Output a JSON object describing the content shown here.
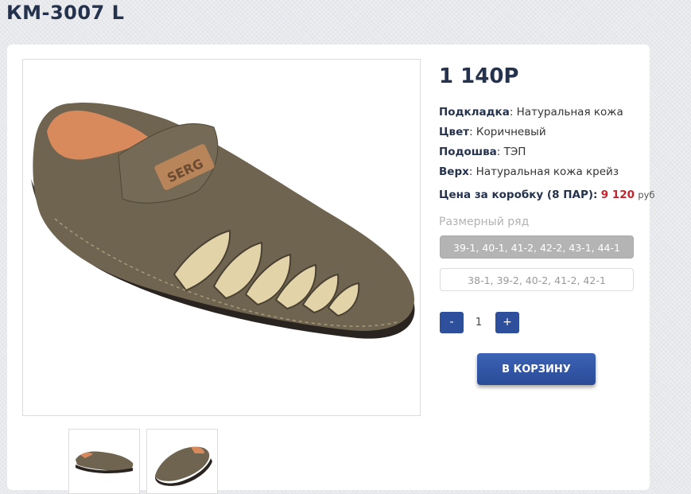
{
  "product": {
    "title": "КМ-3007 L",
    "price": "1 140Р",
    "properties": [
      {
        "label": "Подкладка",
        "value": ": Натуральная кожа"
      },
      {
        "label": "Цвет",
        "value": ": Коричневый"
      },
      {
        "label": "Подошва",
        "value": ": ТЭП"
      },
      {
        "label": "Верх",
        "value": ": Натуральная кожа крейз"
      }
    ],
    "box_price": {
      "label": "Цена за коробку (8 ПАР):",
      "value": "9 120",
      "currency": "руб"
    }
  },
  "sizes": {
    "title": "Размерный ряд",
    "options": [
      {
        "label": "39-1, 40-1, 41-2, 42-2, 43-1, 44-1",
        "selected": true
      },
      {
        "label": "38-1, 39-2, 40-2, 41-2, 42-1",
        "selected": false
      }
    ]
  },
  "quantity": {
    "minus_label": "-",
    "value": "1",
    "plus_label": "+"
  },
  "cart": {
    "button_label": "В КОРЗИНУ"
  },
  "images": {
    "main": "brown-leather-sandal-photo",
    "thumbnails": [
      "sandal-thumbnail-side",
      "sandal-thumbnail-angle"
    ]
  },
  "colors": {
    "title": "#25324e",
    "accent_blue": "#2d4f9c",
    "price_red": "#c8232c",
    "selected_size_bg": "#b4b4b4"
  }
}
